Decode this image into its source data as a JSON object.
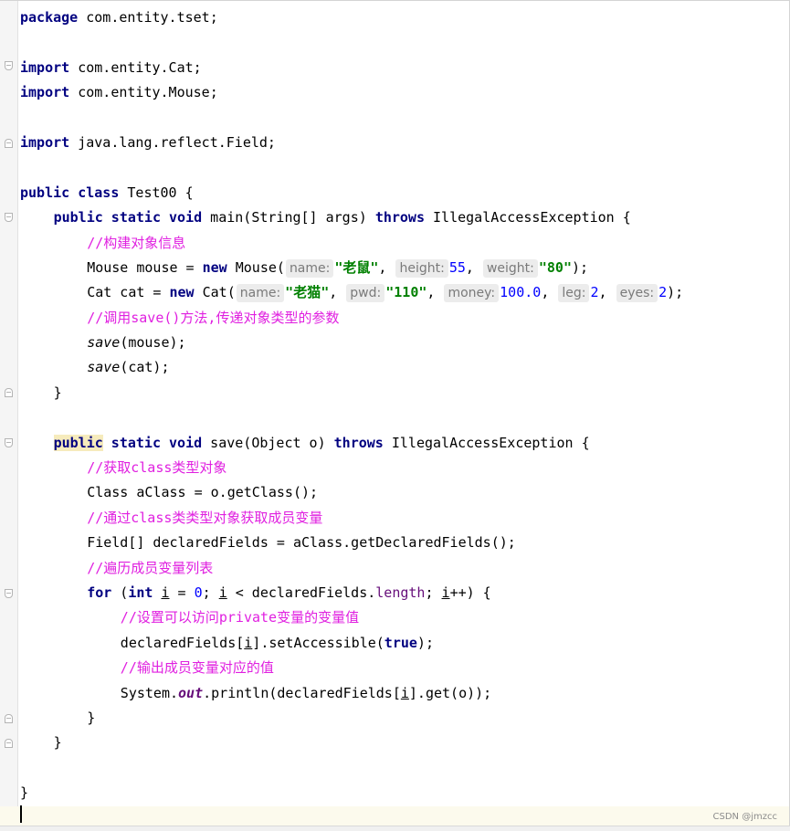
{
  "lines": {
    "pkg_kw": "package",
    "pkg_name": " com.entity.tset;",
    "imp1_kw": "import",
    "imp1_name": " com.entity.Cat;",
    "imp2_kw": "import",
    "imp2_name": " com.entity.Mouse;",
    "imp3_kw": "import",
    "imp3_name": " java.lang.reflect.Field;",
    "cls_kw1": "public",
    "cls_kw2": " class",
    "cls_rest": " Test00 {",
    "main_kw1": "public",
    "main_kw2": " static",
    "main_kw3": " void",
    "main_sig": " main(String[] args) ",
    "main_throws": "throws",
    "main_exc": " IllegalAccessException {",
    "c1": "//构建对象信息",
    "mouse_decl": "Mouse mouse = ",
    "mouse_new": "new",
    "mouse_ctor": " Mouse(",
    "mouse_h1": "name:",
    "mouse_v1": "\"老鼠\"",
    "mouse_h2": "height:",
    "mouse_v2": "55",
    "mouse_h3": "weight:",
    "mouse_v3": "\"80\"",
    "mouse_end": ");",
    "cat_decl": "Cat cat = ",
    "cat_new": "new",
    "cat_ctor": " Cat(",
    "cat_h1": "name:",
    "cat_v1": "\"老猫\"",
    "cat_h2": "pwd:",
    "cat_v2": "\"110\"",
    "cat_h3": "money:",
    "cat_v3": "100.0",
    "cat_h4": "leg:",
    "cat_v4": "2",
    "cat_h5": "eyes:",
    "cat_v5": "2",
    "cat_end": ");",
    "c2": "//调用save()方法,传递对象类型的参数",
    "save1_fn": "save",
    "save1_args": "(mouse);",
    "save2_fn": "save",
    "save2_args": "(cat);",
    "close_main": "}",
    "save_kw1": "public",
    "save_kw2": " static",
    "save_kw3": " void",
    "save_sig": " save(Object o) ",
    "save_throws": "throws",
    "save_exc": " IllegalAccessException {",
    "c3": "//获取class类型对象",
    "aclass": "Class aClass = o.getClass();",
    "c4": "//通过class类类型对象获取成员变量",
    "fields": "Field[] declaredFields = aClass.getDeclaredFields();",
    "c5": "//遍历成员变量列表",
    "for_kw": "for",
    "for_p1": " (",
    "for_int": "int",
    "for_i1": "i",
    "for_eq": " = ",
    "for_zero": "0",
    "for_semi": "; ",
    "for_i2": "i",
    "for_lt": " < declaredFields.",
    "for_len": "length",
    "for_semi2": "; ",
    "for_i3": "i",
    "for_inc": "++) {",
    "c6": "//设置可以访问private变量的变量值",
    "acc_a": "declaredFields[",
    "acc_i": "i",
    "acc_b": "].setAccessible(",
    "acc_true": "true",
    "acc_end": ");",
    "c7": "//输出成员变量对应的值",
    "out_a": "System.",
    "out_out": "out",
    "out_b": ".println(declaredFields[",
    "out_i": "i",
    "out_c": "].get(o));",
    "close_for": "}",
    "close_save": "}",
    "close_class": "}"
  },
  "watermark": "CSDN @jmzcc"
}
